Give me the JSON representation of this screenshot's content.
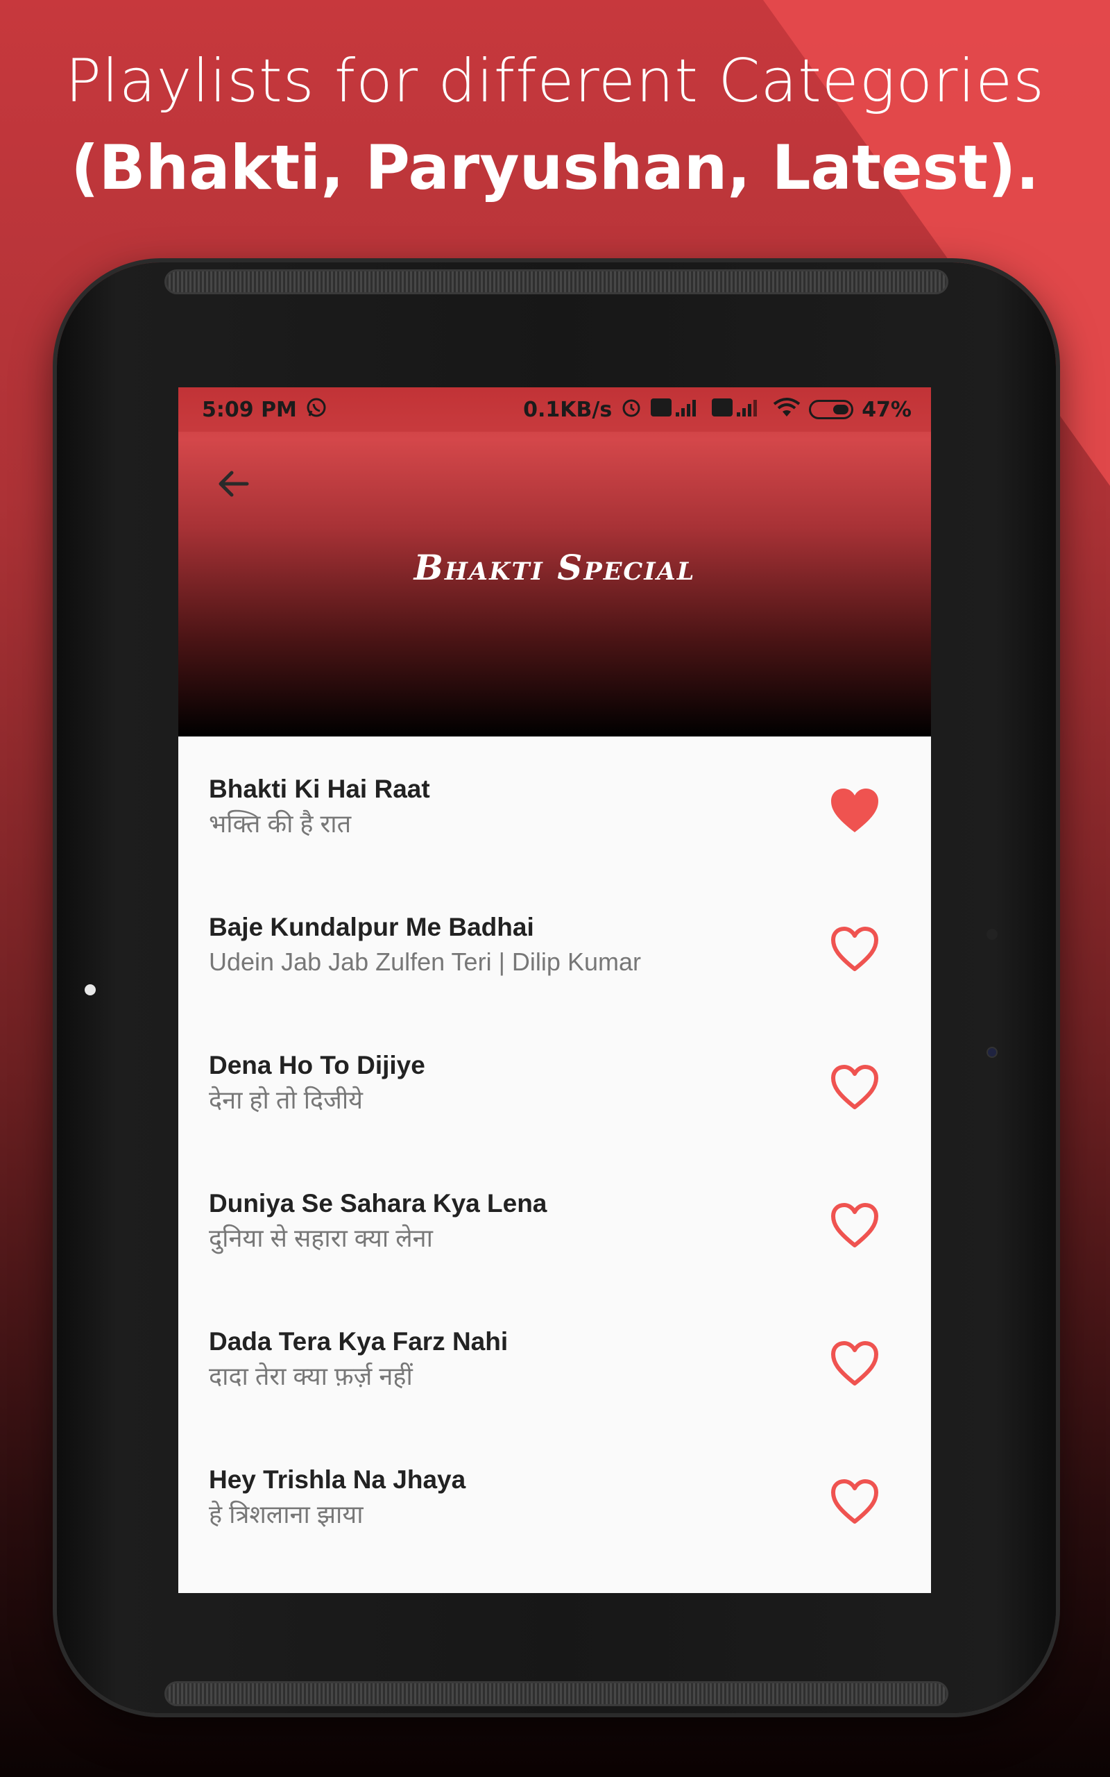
{
  "headline": {
    "line1": "Playlists for different Categories",
    "line2": "(Bhakti, Paryushan, Latest)."
  },
  "status_bar": {
    "time": "5:09 PM",
    "speed": "0.1KB/s",
    "battery": "47%"
  },
  "header": {
    "title": "Bhakti Special"
  },
  "songs": [
    {
      "title": "Bhakti Ki Hai Raat",
      "subtitle": "भक्ति की है रात",
      "favorite": true
    },
    {
      "title": "Baje Kundalpur Me Badhai",
      "subtitle": "Udein Jab Jab Zulfen Teri | Dilip Kumar",
      "favorite": false
    },
    {
      "title": "Dena Ho To Dijiye",
      "subtitle": "देना हो तो दिजीये",
      "favorite": false
    },
    {
      "title": "Duniya Se Sahara Kya Lena",
      "subtitle": "दुनिया से सहारा क्या लेना",
      "favorite": false
    },
    {
      "title": "Dada Tera Kya Farz Nahi",
      "subtitle": "दादा तेरा क्या फ़र्ज़ नहीं",
      "favorite": false
    },
    {
      "title": "Hey Trishla Na Jhaya",
      "subtitle": "हे त्रिशलाना झाया",
      "favorite": false
    }
  ],
  "colors": {
    "accent": "#ef5350",
    "background_top": "#c7383d",
    "header_red": "#d4474a"
  },
  "icons": {
    "back": "arrow-left-icon",
    "favorite_filled": "heart-filled-icon",
    "favorite_outline": "heart-outline-icon",
    "whatsapp": "whatsapp-icon",
    "alarm": "alarm-icon",
    "signal": "signal-icon",
    "wifi": "wifi-icon",
    "battery": "battery-icon"
  }
}
